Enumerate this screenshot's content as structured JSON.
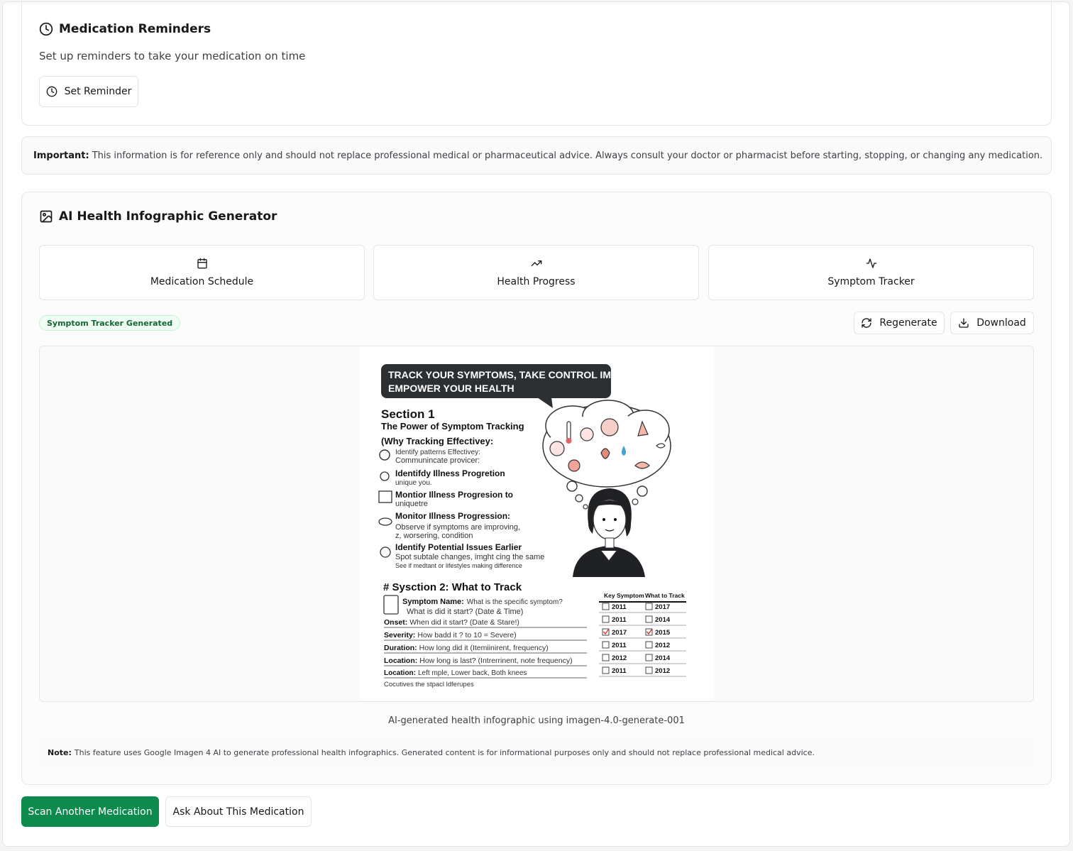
{
  "reminders": {
    "title": "Medication Reminders",
    "description": "Set up reminders to take your medication on time",
    "button_label": "Set Reminder"
  },
  "disclaimer": {
    "label": "Important:",
    "text": "This information is for reference only and should not replace professional medical or pharmaceutical advice. Always consult your doctor or pharmacist before starting, stopping, or changing any medication."
  },
  "generator": {
    "title": "AI Health Infographic Generator",
    "options": [
      {
        "label": "Medication Schedule",
        "icon": "calendar-icon"
      },
      {
        "label": "Health Progress",
        "icon": "trending-up-icon"
      },
      {
        "label": "Symptom Tracker",
        "icon": "activity-icon"
      }
    ],
    "status_badge": "Symptom Tracker Generated",
    "regenerate_label": "Regenerate",
    "download_label": "Download",
    "caption": "AI-generated health infographic using imagen-4.0-generate-001",
    "note_label": "Note:",
    "note_text": "This feature uses Google Imagen 4 AI to generate professional health infographics. Generated content is for informational purposes only and should not replace professional medical advice."
  },
  "infographic": {
    "bubble_line1": "TRACK YOUR SYMPTOMS, TAKE CONTROL IM HEALTH",
    "bubble_line2": "EMPOWER YOUR HEALTH",
    "section1_title": "Section 1",
    "section1_subtitle": "The Power of Symptom Tracking",
    "section1_heading": "(Why Tracking Effectivey:",
    "items": [
      {
        "title": "Identify patterns Effectivey:",
        "detail": "Communincate provicer:"
      },
      {
        "title": "Identifdy Illness Progretion",
        "detail": "unique you."
      },
      {
        "title": "Montior Illness Progresion to",
        "detail": "uniquetre"
      },
      {
        "title": "Monitor Illness Progression:",
        "detail": "Observe if symptoms are improving,",
        "detail2": "z, worsering,  condition"
      },
      {
        "title": "Identify Potential Issues Earlier",
        "detail": "Spot subtale changes, imght cing  the same",
        "detail2": "See if medtant or lifestyles making difference"
      }
    ],
    "section2_title": "# Sysction 2: What to Track",
    "track_rows": [
      {
        "label": "Symptom Name:",
        "text": "What is the specific symptom?"
      },
      {
        "label": "",
        "text": "What is did it start? (Date & Time)"
      },
      {
        "label": "Onset:",
        "text": "When did it start? (Date & Stare!)"
      },
      {
        "label": "Severity:",
        "text": "How badd it ? to 10 = Severe)"
      },
      {
        "label": "Duration:",
        "text": "How long did it (Itemiinirent, frequency)"
      },
      {
        "label": "Location:",
        "text": "How long is last? (Intrerrinent, note frequency)"
      },
      {
        "label": "Location:",
        "text": "Left mple, Lower back, Both knees"
      }
    ],
    "footer_text": "Cocutives the stpacl ldferupes",
    "table_headers": [
      "Key Symptom",
      "What to Track"
    ],
    "table_rows": [
      {
        "a": "2011",
        "b": "2017",
        "checked": false
      },
      {
        "a": "2011",
        "b": "2014",
        "checked": false
      },
      {
        "a": "2017",
        "b": "2015",
        "checked": true
      },
      {
        "a": "2011",
        "b": "2012",
        "checked": false
      },
      {
        "a": "2012",
        "b": "2014",
        "checked": false
      },
      {
        "a": "2011",
        "b": "2012",
        "checked": false
      }
    ]
  },
  "actions": {
    "primary_label": "Scan Another Medication",
    "secondary_label": "Ask About This Medication"
  },
  "colors": {
    "primary": "#0f8a4f",
    "badge_text": "#166534"
  }
}
